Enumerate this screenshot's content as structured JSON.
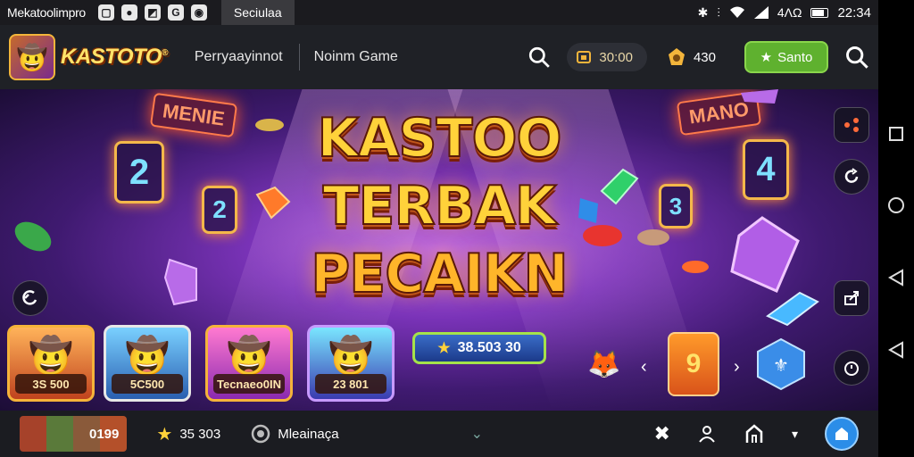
{
  "statusbar": {
    "app_name": "Mekatoolimpro",
    "icons": [
      "square-icon",
      "circle-icon",
      "gallery-icon",
      "g-icon",
      "o-icon"
    ],
    "tab": "Seciulaa",
    "signal_text": "4ΛΩ",
    "time": "22:34"
  },
  "header": {
    "logo_text": "KASTOTO",
    "nav_link_1": "Perryaayinnot",
    "nav_link_2": "Noinm Game",
    "coin_value": "30:00",
    "badge_value": "430",
    "green_button": "Santo"
  },
  "hero": {
    "title_1": "KASTOO",
    "title_2": "TERBAK",
    "title_3": "PECAIKN",
    "neon_left": "MENIE",
    "neon_right": "MANO",
    "numbers": [
      "2",
      "2",
      "4",
      "3"
    ],
    "score_value": "38.503 30"
  },
  "games": [
    {
      "label": "3S 500",
      "face": "🤠"
    },
    {
      "label": "5C500",
      "face": "🤠"
    },
    {
      "label": "Tecnaeo0IN",
      "face": "🤠"
    },
    {
      "label": "23 801",
      "face": "🤠"
    }
  ],
  "bottombar": {
    "thumb_value": "0199",
    "star_value": "35 303",
    "menu_label": "Mleainaça"
  },
  "colors": {
    "accent_green": "#5fb12f",
    "accent_gold": "#ffd23a",
    "hero_purple": "#7a33b8"
  }
}
